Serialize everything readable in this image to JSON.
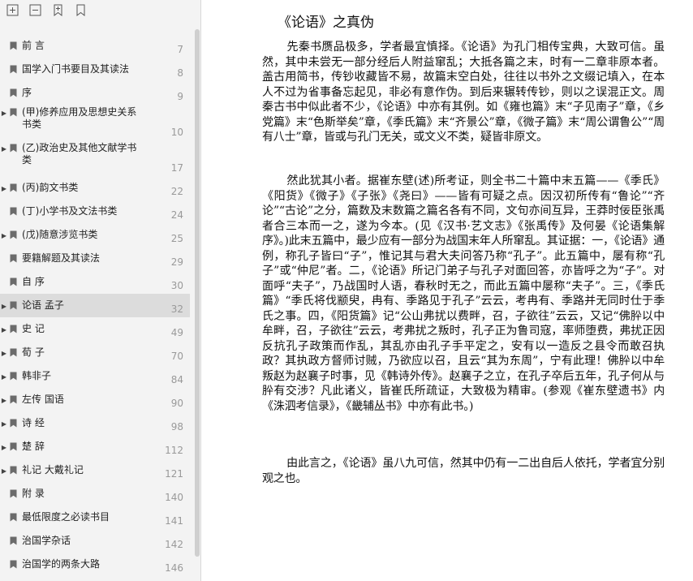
{
  "toolbar": {
    "buttons": [
      {
        "icon": "expand-all-icon"
      },
      {
        "icon": "collapse-all-icon"
      },
      {
        "icon": "add-bookmark-icon"
      },
      {
        "icon": "bookmark-icon"
      }
    ]
  },
  "toc": {
    "items": [
      {
        "label": "前 言",
        "page": "7",
        "expandable": false
      },
      {
        "label": "国学入门书要目及其读法",
        "page": "8",
        "expandable": false
      },
      {
        "label": "序",
        "page": "9",
        "expandable": false
      },
      {
        "label": "(甲)修养应用及思想史关系书类",
        "page": "10",
        "expandable": true
      },
      {
        "label": "(乙)政治史及其他文献学书类",
        "page": "17",
        "expandable": true
      },
      {
        "label": "(丙)韵文书类",
        "page": "22",
        "expandable": true
      },
      {
        "label": "(丁)小学书及文法书类",
        "page": "24",
        "expandable": false
      },
      {
        "label": "(戊)随意涉览书类",
        "page": "25",
        "expandable": true
      },
      {
        "label": "要籍解题及其读法",
        "page": "29",
        "expandable": false
      },
      {
        "label": "自 序",
        "page": "30",
        "expandable": false
      },
      {
        "label": "论语 孟子",
        "page": "32",
        "expandable": true,
        "active": true
      },
      {
        "label": "史 记",
        "page": "49",
        "expandable": true
      },
      {
        "label": "荀 子",
        "page": "70",
        "expandable": true
      },
      {
        "label": "韩非子",
        "page": "84",
        "expandable": true
      },
      {
        "label": "左传 国语",
        "page": "90",
        "expandable": true
      },
      {
        "label": "诗 经",
        "page": "98",
        "expandable": true
      },
      {
        "label": "楚 辞",
        "page": "112",
        "expandable": true
      },
      {
        "label": "礼记 大戴礼记",
        "page": "121",
        "expandable": true
      },
      {
        "label": "附 录",
        "page": "140",
        "expandable": false
      },
      {
        "label": "最低限度之必读书目",
        "page": "141",
        "expandable": false
      },
      {
        "label": "治国学杂话",
        "page": "142",
        "expandable": false
      },
      {
        "label": "治国学的两条大路",
        "page": "146",
        "expandable": false
      }
    ]
  },
  "content": {
    "title": "《论语》之真伪",
    "paragraphs": [
      "先秦书赝品极多，学者最宜慎择。《论语》为孔门相传宝典，大致可信。虽然，其中未尝无一部分经后人附益窜乱；大抵各篇之末，时有一二章非原本者。盖古用简书，传钞收藏皆不易，故篇末空白处，往往以书外之文缀记填入，在本人不过为省事备忘起见，非必有意作伪。到后来辗转传钞，则以之误混正文。周秦古书中似此者不少，《论语》中亦有其例。如《雍也篇》末“子见南子”章，《乡党篇》末“色斯举矣”章，《季氏篇》末“齐景公”章，《微子篇》末“周公谓鲁公”“周有八士”章，皆或与孔门无关，或文义不类，疑皆非原文。",
      "然此犹其小者。据崔东壁(述)所考证，则全书二十篇中末五篇——《季氏》《阳货》《微子》《子张》《尧曰》——皆有可疑之点。因汉初所传有“鲁论”“齐论”“古论”之分，篇数及末数篇之篇名各有不同，文句亦间互异，王莽时佞臣张禹者合三本而一之，遂为今本。(见《汉书·艺文志》《张禹传》及何晏《论语集解序》。)此末五篇中，最少应有一部分为战国末年人所窜乱。其证据：一，《论语》通例，称孔子皆曰“子”，惟记其与君大夫问答乃称“孔子”。此五篇中，屡有称“孔子”或“仲尼”者。二，《论语》所记门弟子与孔子对面回答，亦皆呼之为“子”。对面呼“夫子”，乃战国时人语，春秋时无之，而此五篇中屡称“夫子”。三，《季氏篇》“季氏将伐颛臾，冉有、季路见于孔子”云云，考冉有、季路并无同时仕于季氏之事。四，《阳货篇》记“公山弗扰以费畔，召，子欲往”云云，又记“佛肸以中牟畔，召，子欲往”云云，考弗扰之叛时，孔子正为鲁司寇，率师堕费，弗扰正因反抗孔子政策而作乱，其乱亦由孔子手平定之，安有以一造反之县令而敢召执政？其执政方督师讨贼，乃欲应以召，且云“其为东周”，宁有此理！佛肸以中牟叛赵为赵襄子时事，见《韩诗外传》。赵襄子之立，在孔子卒后五年，孔子何从与肸有交涉？凡此诸义，皆崔氏所疏证，大致极为精审。(参观《崔东壁遗书》内《洙泗考信录》，《畿辅丛书》中亦有此书。)",
      "由此言之，《论语》虽八九可信，然其中仍有一二出自后人依托，学者宜分别观之也。"
    ]
  }
}
